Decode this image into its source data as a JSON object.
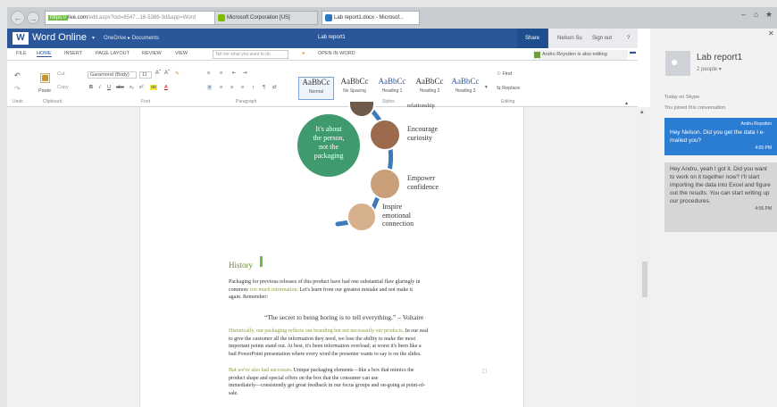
{
  "browser": {
    "url_host": "https://",
    "url_mid": "live.com",
    "url_rest": "/edit.aspx?cid=8547...16-5386-3d&app=Word",
    "tab_microsoft": "Microsoft Corporation [US]",
    "tab_doc": "Lab report1.docx - Microsof..."
  },
  "header": {
    "app": "Word Online",
    "path": "OneDrive ▸ Documents",
    "doc_title": "Lab report1",
    "share": "Share",
    "user": "Nelson Su",
    "signout": "Sign out",
    "help": "?"
  },
  "menu": {
    "items": [
      "FILE",
      "HOME",
      "INSERT",
      "PAGE LAYOUT",
      "REVIEW",
      "VIEW"
    ],
    "tellme": "Tell me what you want to do",
    "open_in_word": "OPEN IN WORD",
    "editing": "Andru Roysden is also editing"
  },
  "ribbon": {
    "cut": "Cut",
    "copy": "Copy",
    "paste": "Paste",
    "font": "Garamond (Body)",
    "size": "11",
    "groups": [
      "Undo",
      "Clipboard",
      "Font",
      "Paragraph",
      "Styles",
      "Editing"
    ],
    "styles": [
      {
        "preview": "AaBbCc",
        "name": "Normal"
      },
      {
        "preview": "AaBbCc",
        "name": "No Spacing"
      },
      {
        "preview": "AaBbCc",
        "name": "Heading 1"
      },
      {
        "preview": "AaBbCc",
        "name": "Heading 2"
      },
      {
        "preview": "AaBbCc",
        "name": "Heading 3"
      }
    ],
    "find": "Find",
    "replace": "Replace"
  },
  "doc": {
    "top_label": "relationship",
    "encourage": [
      "Encourage",
      "curiosity"
    ],
    "circle": [
      "It's about",
      "the person,",
      "not the",
      "packaging"
    ],
    "empower": [
      "Empower",
      "confidence"
    ],
    "inspire": [
      "Inspire",
      "emotional",
      "connection"
    ],
    "heading": "History",
    "p1": [
      "Packaging for previous releases of this product have had one substantial flaw glaringly in",
      "common: ",
      "too much information",
      ". Let's learn from our greatest mistake and not make it",
      "again. Remember:"
    ],
    "quote": "“The secret to being boring is to tell everything.” – Voltaire",
    "p2": [
      "Historically, our packaging reflects our branding but not necessarily our products",
      ". In our zeal",
      "to give the customer all the information they need, we lose the ability to make the most",
      "important points stand out. At best, it's been information overload; at worst it's been like a",
      "bad PowerPoint presentation where every word the presenter wants to say is on the slides."
    ],
    "p3": [
      "But we've also had successes",
      ". Unique packaging elements—like a box that mimics the",
      "product shape and special offers on the box that the consumer can use",
      "immediately—consistently get great feedback in our focus groups and on-going at point-of-",
      "sale."
    ]
  },
  "chat": {
    "title": "Lab report1",
    "people": "2 people ▾",
    "today": "Today on Skype",
    "joined": "You joined this conversation.",
    "m1_author": "Andru Roysden",
    "m1_text": "Hey Nelson. Did you get the data I e-mailed you?",
    "m1_time": "4:05 PM",
    "m2_text": "Hey Andru, yeah I got it. Did you want to work on it together now? I'll start importing the data into Excel and figure out the results. You can start writing up our procedures.",
    "m2_time": "4:06 PM"
  }
}
